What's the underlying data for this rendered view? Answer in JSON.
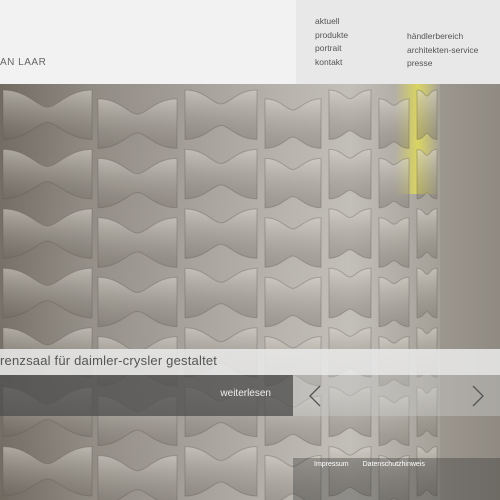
{
  "brand": {
    "name": "AN LAAR"
  },
  "nav": {
    "primary": [
      "aktuell",
      "produkte",
      "portrait",
      "kontakt"
    ],
    "secondary": [
      "händlerbereich",
      "architekten-service",
      "presse"
    ]
  },
  "hero": {
    "caption": "renzsaal für daimler-crysler gestaltet",
    "read_more": "weiterlesen",
    "prev_icon": "chevron-left-icon",
    "next_icon": "chevron-right-icon"
  },
  "footer": {
    "links": [
      "Impressum",
      "Datenschutzhinweis"
    ]
  },
  "colors": {
    "accent_light": "#e3dc57",
    "panel": "#e8e8e8",
    "readmore_bg": "#505050"
  }
}
